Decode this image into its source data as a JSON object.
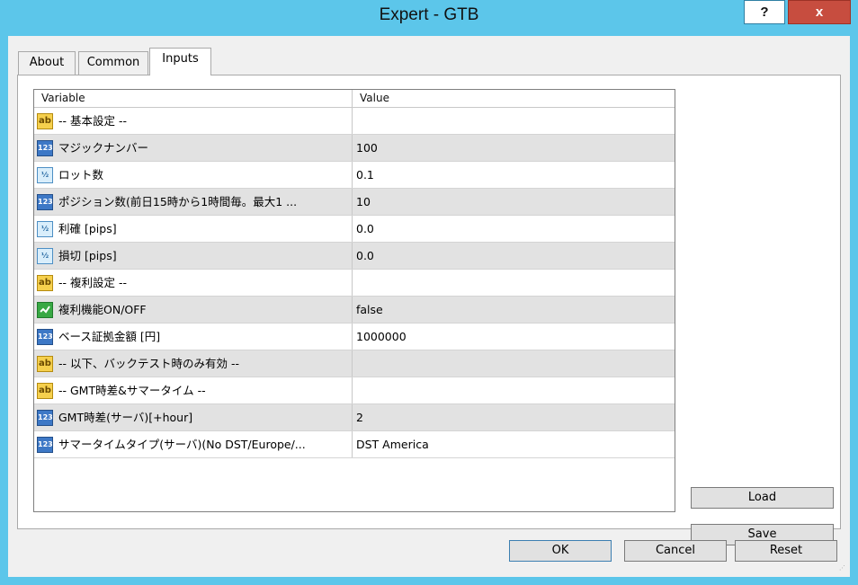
{
  "window": {
    "title": "Expert - GTB",
    "help_label": "?",
    "close_label": "x"
  },
  "tabs": [
    {
      "label": "About"
    },
    {
      "label": "Common"
    },
    {
      "label": "Inputs"
    }
  ],
  "grid": {
    "headers": {
      "variable": "Variable",
      "value": "Value"
    },
    "rows": [
      {
        "icon": "ab",
        "variable": "-- 基本設定 --",
        "value": ""
      },
      {
        "icon": "123",
        "variable": "マジックナンバー",
        "value": "100"
      },
      {
        "icon": "1/2",
        "variable": "ロット数",
        "value": "0.1"
      },
      {
        "icon": "123",
        "variable": "ポジション数(前日15時から1時間毎。最大1 ...",
        "value": "10"
      },
      {
        "icon": "1/2",
        "variable": "利確 [pips]",
        "value": "0.0"
      },
      {
        "icon": "1/2",
        "variable": "損切 [pips]",
        "value": "0.0"
      },
      {
        "icon": "ab",
        "variable": "-- 複利設定 --",
        "value": ""
      },
      {
        "icon": "bool",
        "variable": "複利機能ON/OFF",
        "value": "false"
      },
      {
        "icon": "123",
        "variable": "ベース証拠金額 [円]",
        "value": "1000000"
      },
      {
        "icon": "ab",
        "variable": "-- 以下、バックテスト時のみ有効 --",
        "value": ""
      },
      {
        "icon": "ab",
        "variable": "-- GMT時差&サマータイム --",
        "value": ""
      },
      {
        "icon": "123",
        "variable": "GMT時差(サーバ)[+hour]",
        "value": "2"
      },
      {
        "icon": "123",
        "variable": "サマータイムタイプ(サーバ)(No DST/Europe/...",
        "value": "DST America"
      }
    ]
  },
  "buttons": {
    "load": "Load",
    "save": "Save",
    "ok": "OK",
    "cancel": "Cancel",
    "reset": "Reset"
  },
  "icons": {
    "string": "ab",
    "integer": "123",
    "double": "½",
    "bool": "check"
  }
}
